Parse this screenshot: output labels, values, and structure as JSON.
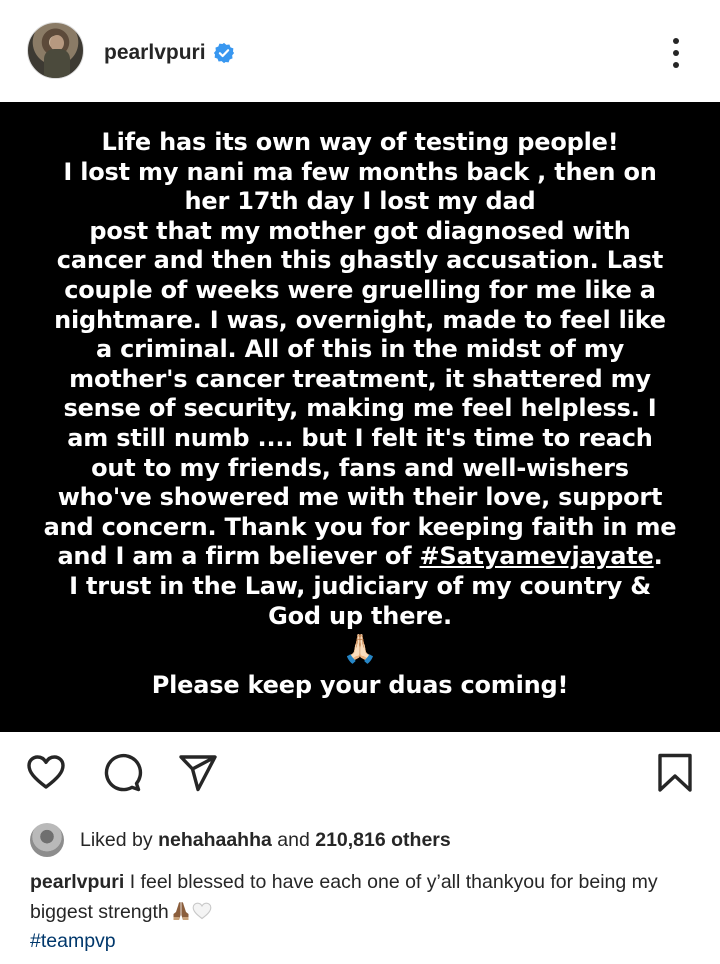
{
  "header": {
    "username": "pearlvpuri",
    "verified": true
  },
  "post": {
    "lines": [
      "Life has its own way of testing people!",
      "I lost my nani ma few months back , then on",
      "her 17th day I lost my dad",
      "post that my mother got diagnosed with",
      "cancer and then this ghastly accusation. Last",
      "couple of weeks were gruelling for me like a",
      "nightmare. I was, overnight, made to feel like",
      "a criminal. All of this in the midst of my",
      "mother's cancer treatment, it shattered my",
      "sense of security, making me feel helpless. I",
      "am still numb .... but I felt it's time to reach",
      "out to my friends, fans and well-wishers",
      "who've showered me with their love, support",
      "and concern. Thank you for keeping faith in me"
    ],
    "line_believer_prefix": "and I am a firm believer of ",
    "line_believer_tag": "#Satyamevjayate",
    "line_believer_suffix": ".",
    "line_law": "I trust in the Law, judiciary of my country &",
    "line_god": "God up there.",
    "pray_emoji": "🙏🏻",
    "closing": "Please keep your duas coming!"
  },
  "actions": {
    "like_icon": "heart-outline-icon",
    "comment_icon": "comment-icon",
    "share_icon": "send-icon",
    "save_icon": "bookmark-icon"
  },
  "likes": {
    "prefix": "Liked by ",
    "user": "nehahaahha",
    "middle": " and ",
    "count": "210,816 others"
  },
  "caption": {
    "username": "pearlvpuri",
    "text": " I feel blessed to have each one of y’all thankyou for being my biggest strength",
    "hashtag": "#teampvp"
  },
  "colors": {
    "verified_blue": "#3897f0",
    "hashtag_blue": "#00376b",
    "post_background": "#000000",
    "post_text": "#ffffff"
  }
}
